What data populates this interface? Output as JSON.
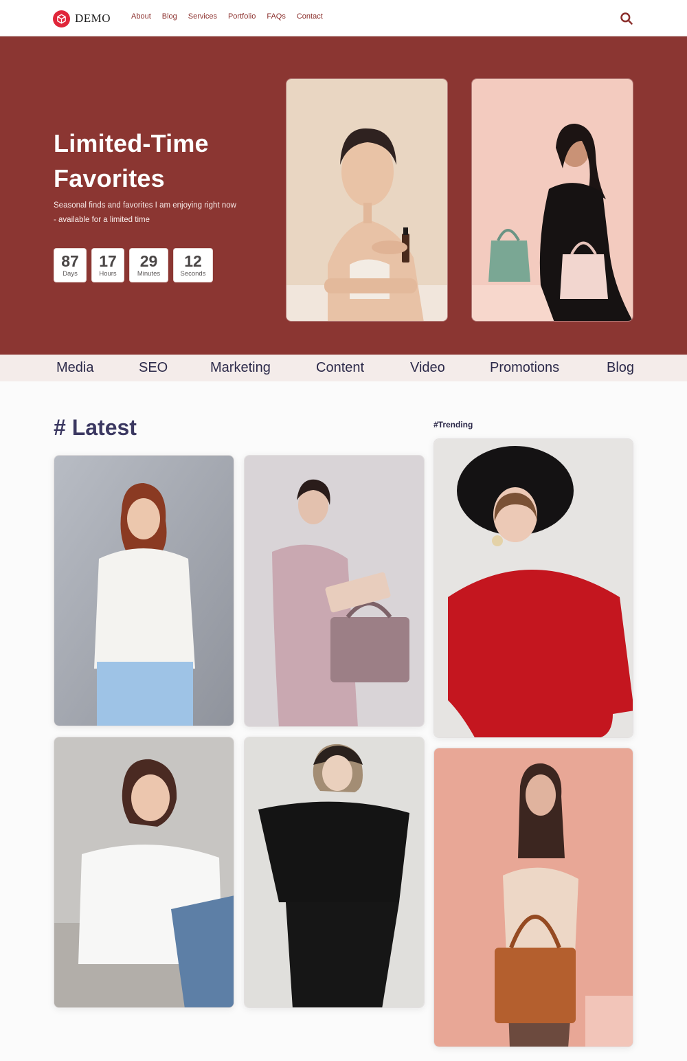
{
  "brand": {
    "name": "DEMO",
    "logo_icon": "cube-icon",
    "accent": "#e0263a"
  },
  "nav": {
    "items": [
      "About",
      "Blog",
      "Services",
      "Portfolio",
      "FAQs",
      "Contact"
    ],
    "color": "#8b2f2c",
    "search_icon": "search-icon"
  },
  "hero": {
    "background": "#8b3632",
    "title_line1": "Limited-Time",
    "title_line2": "Favorites",
    "subtitle": "Seasonal finds and favorites I am enjoying right now - available for a limited time",
    "countdown": [
      {
        "value": "87",
        "label": "Days"
      },
      {
        "value": "17",
        "label": "Hours"
      },
      {
        "value": "29",
        "label": "Minutes"
      },
      {
        "value": "12",
        "label": "Seconds"
      }
    ]
  },
  "categories": [
    "Media",
    "SEO",
    "Marketing",
    "Content",
    "Video",
    "Promotions",
    "Blog"
  ],
  "latest": {
    "heading": "# Latest"
  },
  "trending": {
    "heading": "#Trending"
  }
}
